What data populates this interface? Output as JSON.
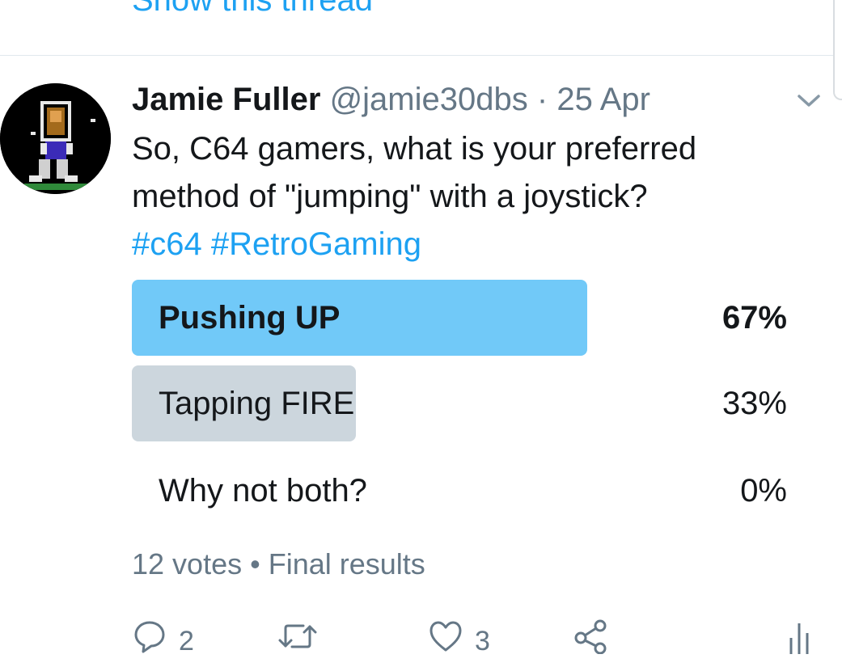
{
  "thread": {
    "show_thread_label": "Show this thread"
  },
  "tweet": {
    "author_name": "Jamie Fuller",
    "author_handle": "@jamie30dbs",
    "separator": "·",
    "date": "25 Apr",
    "text_line1": "So, C64 gamers, what is your preferred",
    "text_line2": "method of \"jumping\" with a joystick?",
    "hashtags": [
      "#c64",
      "#RetroGaming"
    ]
  },
  "poll": {
    "options": [
      {
        "label": "Pushing UP",
        "percent_label": "67%",
        "fraction": 0.67,
        "winner": true
      },
      {
        "label": "Tapping FIRE",
        "percent_label": "33%",
        "fraction": 0.33,
        "winner": false
      },
      {
        "label": "Why not both?",
        "percent_label": "0%",
        "fraction": 0,
        "winner": false
      }
    ],
    "votes": "12 votes",
    "bullet": "•",
    "status": "Final results"
  },
  "actions": {
    "reply_count": "2",
    "like_count": "3",
    "icons": [
      "reply-icon",
      "retweet-icon",
      "like-icon",
      "share-icon",
      "analytics-icon"
    ]
  },
  "colors": {
    "accent": "#1da1f2",
    "winner_bar": "#71c9f8",
    "loser_bar": "#ccd6dd",
    "secondary_text": "#657786"
  }
}
